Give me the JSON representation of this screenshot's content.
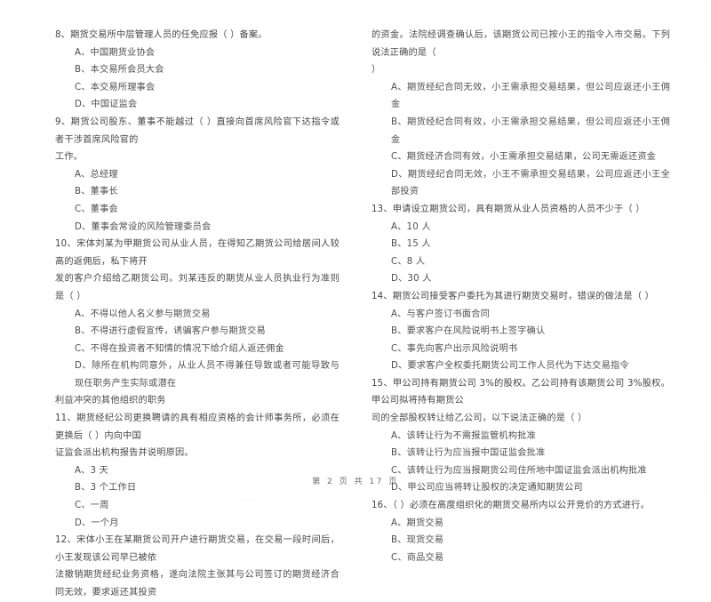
{
  "document": {
    "kind": "scanned-exam-page",
    "language": "zh-CN"
  },
  "footer": {
    "page_label": "第 2 页  共 17 页"
  },
  "left_column": {
    "blocks": [
      {
        "type": "question",
        "text": "8、期货交易所中层管理人员的任免应报（      ）备案。"
      },
      {
        "type": "option",
        "text": "A、中国期货业协会"
      },
      {
        "type": "option",
        "text": "B、本交易所会员大会"
      },
      {
        "type": "option",
        "text": "C、本交易所理事会"
      },
      {
        "type": "option",
        "text": "D、中国证监会"
      },
      {
        "type": "question",
        "text": "9、期货公司股东、董事不能越过（        ）直接向首席风险官下达指令或者干涉首席风险官的"
      },
      {
        "type": "continuation",
        "text": "工作。"
      },
      {
        "type": "option",
        "text": "A、总经理"
      },
      {
        "type": "option",
        "text": "B、董事长"
      },
      {
        "type": "option",
        "text": "C、董事会"
      },
      {
        "type": "option",
        "text": "D、董事会常设的风险管理委员会"
      },
      {
        "type": "question",
        "text": "10、宋体刘某为甲期货公司从业人员，在得知乙期货公司给居间人较高的返佣后，私下将开"
      },
      {
        "type": "continuation",
        "text": "发的客户介绍给乙期货公司。刘某违反的期货从业人员执业行为准则是（      ）"
      },
      {
        "type": "option",
        "text": "A、不得以他人名义参与期货交易"
      },
      {
        "type": "option",
        "text": "B、不得进行虚假宣传，诱骗客户参与期货交易"
      },
      {
        "type": "option",
        "text": "C、不得在投资者不知情的情况下给介绍人返还佣金"
      },
      {
        "type": "option",
        "text": "D、除所在机构同意外，从业人员不得兼任导致或者可能导致与现任职务产生实际或潜在"
      },
      {
        "type": "continuation",
        "text": "利益冲突的其他组织的职务"
      },
      {
        "type": "question",
        "text": "11、期货经纪公司更换聘请的具有相应资格的会计师事务所，必须在更换后（      ）内向中国"
      },
      {
        "type": "continuation",
        "text": "证监会派出机构报告并说明原因。"
      },
      {
        "type": "option",
        "text": "A、3 天"
      },
      {
        "type": "option",
        "text": "B、3 个工作日"
      },
      {
        "type": "option",
        "text": "C、一周"
      },
      {
        "type": "option",
        "text": "D、一个月"
      },
      {
        "type": "question",
        "text": "12、宋体小王在某期货公司开户进行期货交易，在交易一段时间后，小王发现该公司早已被依"
      },
      {
        "type": "continuation",
        "text": "法撤销期货经纪业务资格，遂向法院主张其与公司签订的期货经济合同无效，要求返还其投资"
      }
    ]
  },
  "right_column": {
    "blocks": [
      {
        "type": "continuation",
        "text": "的资金。法院经调查确认后，该期货公司已按小王的指令入市交易。下列说法正确的是（"
      },
      {
        "type": "continuation",
        "text": "）"
      },
      {
        "type": "option",
        "text": "A、期货经纪合同无效，小王需承担交易结果，但公司应返还小王佣金"
      },
      {
        "type": "option",
        "text": "B、期货经纪合同有效，小王需承担交易结果，但公司应返还小王佣金"
      },
      {
        "type": "option",
        "text": "C、期货经济合同有效，小王需承担交易结果，公司无需返还资金"
      },
      {
        "type": "option",
        "text": "D、期货经纪合同无效，小王不需承担交易结果，公司应返还小王全部投资"
      },
      {
        "type": "question",
        "text": "13、申请设立期货公司，具有期货从业人员资格的人员不少于（      ）"
      },
      {
        "type": "option",
        "text": "A、10 人"
      },
      {
        "type": "option",
        "text": "B、15 人"
      },
      {
        "type": "option",
        "text": "C、8 人"
      },
      {
        "type": "option",
        "text": "D、30 人"
      },
      {
        "type": "question",
        "text": "14、期货公司接受客户委托为其进行期货交易时，错误的做法是（      ）"
      },
      {
        "type": "option",
        "text": "A、与客户签订书面合同"
      },
      {
        "type": "option",
        "text": "B、要求客户在风险说明书上签字确认"
      },
      {
        "type": "option",
        "text": "C、事先向客户出示风险说明书"
      },
      {
        "type": "option",
        "text": "D、要求客户全权委托期货公司工作人员代为下达交易指令"
      },
      {
        "type": "question",
        "text": "15、甲公司持有期货公司 3%的股权。乙公司持有该期货公司 3%股权。甲公司拟将持有期货公"
      },
      {
        "type": "continuation",
        "text": "司的全部股权转让给乙公司，以下说法正确的是（      ）"
      },
      {
        "type": "option",
        "text": "A、该转让行为不需报监管机构批准"
      },
      {
        "type": "option",
        "text": "B、该转让行为应当报中国证监会批准"
      },
      {
        "type": "option",
        "text": "C、该转让行为应当报期货公司住所地中国证监会派出机构批准"
      },
      {
        "type": "option",
        "text": "D、甲公司应当将转让股权的决定通知期货公司"
      },
      {
        "type": "question",
        "text": "16、（      ）必须在高度组织化的期货交易所内以公开竞价的方式进行。"
      },
      {
        "type": "option",
        "text": "A、期货交易"
      },
      {
        "type": "option",
        "text": "B、现货交易"
      },
      {
        "type": "option",
        "text": "C、商品交易"
      }
    ]
  }
}
